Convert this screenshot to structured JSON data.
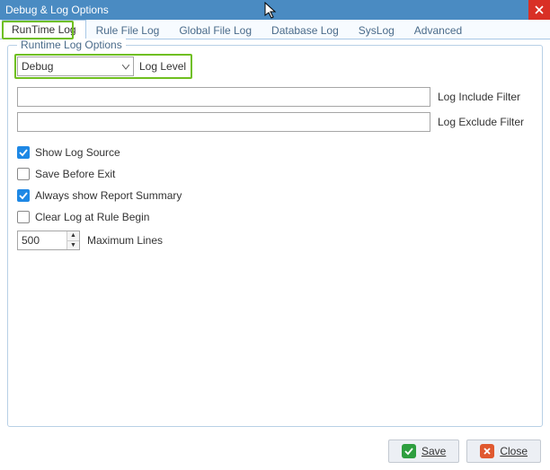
{
  "window": {
    "title": "Debug & Log Options"
  },
  "tabs": [
    {
      "label": "RunTime Log",
      "active": true
    },
    {
      "label": "Rule File Log",
      "active": false
    },
    {
      "label": "Global File Log",
      "active": false
    },
    {
      "label": "Database Log",
      "active": false
    },
    {
      "label": "SysLog",
      "active": false
    },
    {
      "label": "Advanced",
      "active": false
    }
  ],
  "fieldset": {
    "legend": "Runtime Log Options",
    "loglevel": {
      "value": "Debug",
      "label": "Log Level"
    },
    "filters": {
      "include": {
        "value": "",
        "label": "Log Include Filter"
      },
      "exclude": {
        "value": "",
        "label": "Log Exclude Filter"
      }
    },
    "checks": {
      "show_source": {
        "label": "Show Log Source",
        "checked": true
      },
      "save_before_exit": {
        "label": "Save Before Exit",
        "checked": false
      },
      "report_summary": {
        "label": "Always show Report Summary",
        "checked": true
      },
      "clear_at_begin": {
        "label": "Clear Log at Rule Begin",
        "checked": false
      }
    },
    "max_lines": {
      "value": "500",
      "label": "Maximum Lines"
    }
  },
  "footer": {
    "save": "Save",
    "close": "Close"
  }
}
